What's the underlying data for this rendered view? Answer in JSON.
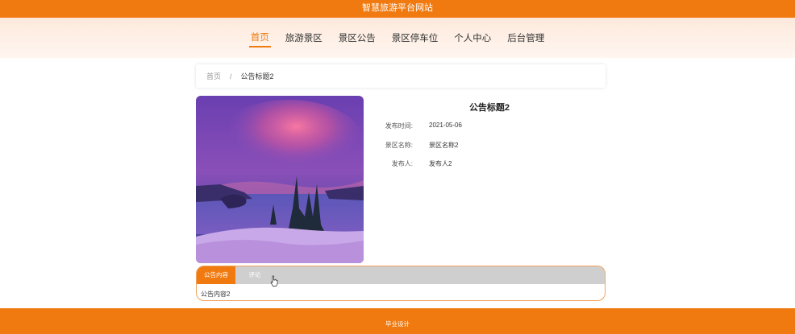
{
  "site": {
    "title": "智慧旅游平台网站"
  },
  "nav": {
    "items": [
      {
        "label": "首页",
        "active": true
      },
      {
        "label": "旅游景区"
      },
      {
        "label": "景区公告"
      },
      {
        "label": "景区停车位"
      },
      {
        "label": "个人中心"
      },
      {
        "label": "后台管理"
      }
    ]
  },
  "breadcrumb": {
    "home": "首页",
    "separator": "/",
    "current": "公告标题2"
  },
  "notice": {
    "title": "公告标题2",
    "fields": [
      {
        "key": "发布时间:",
        "value": "2021-05-06"
      },
      {
        "key": "景区名称:",
        "value": "景区名称2"
      },
      {
        "key": "发布人:",
        "value": "发布人2"
      }
    ]
  },
  "tabs": {
    "items": [
      {
        "label": "公告内容",
        "active": true
      },
      {
        "label": "评论"
      }
    ],
    "content": "公告内容2"
  },
  "footer": {
    "text": "毕业设计"
  },
  "colors": {
    "accent": "#f07a10",
    "tab_inactive": "#cfcfcf"
  }
}
